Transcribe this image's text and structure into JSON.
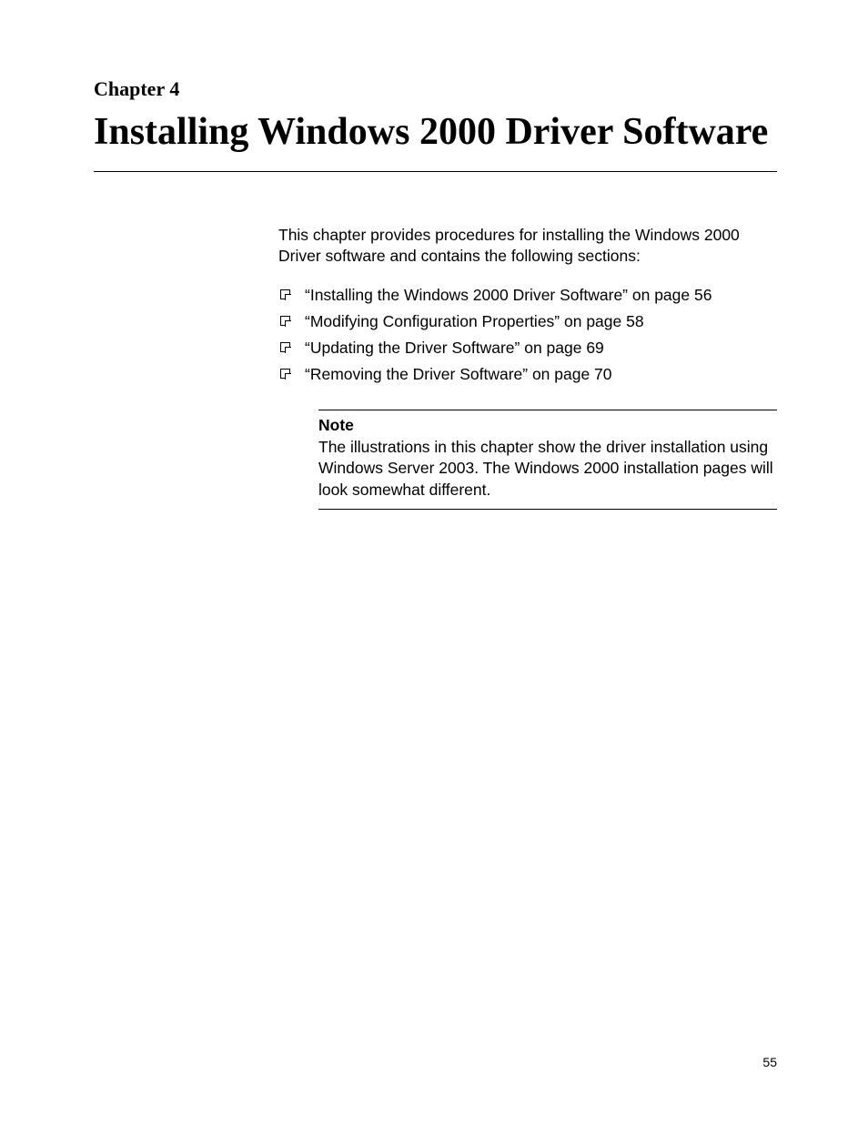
{
  "chapter": {
    "label": "Chapter 4",
    "title": "Installing Windows 2000 Driver Software"
  },
  "intro": "This chapter provides procedures for installing the Windows 2000 Driver software and contains the following sections:",
  "toc": [
    "“Installing the Windows 2000 Driver Software” on page 56",
    "“Modifying Configuration Properties” on page 58",
    "“Updating the Driver Software” on page 69",
    "“Removing the Driver Software” on page 70"
  ],
  "note": {
    "label": "Note",
    "text": "The illustrations in this chapter show the driver installation using Windows Server 2003. The Windows 2000 installation pages will look somewhat different."
  },
  "pageNumber": "55"
}
